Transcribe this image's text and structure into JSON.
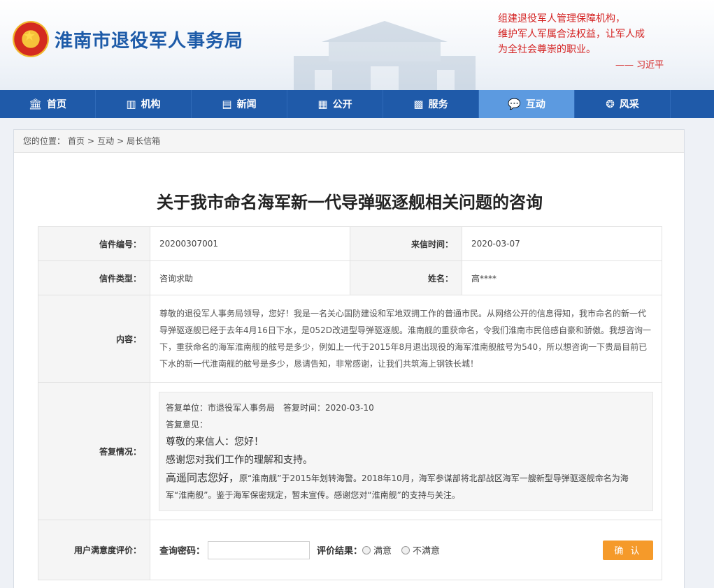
{
  "header": {
    "site_title": "淮南市退役军人事务局",
    "quote_lines": [
      "组建退役军人管理保障机构，",
      "维护军人军属合法权益，让军人成",
      "为全社会尊崇的职业。"
    ],
    "quote_author": "—— 习近平"
  },
  "nav": {
    "items": [
      {
        "label": "首页",
        "icon": "bank-icon",
        "glyph": "🏛"
      },
      {
        "label": "机构",
        "icon": "building-icon",
        "glyph": "▥"
      },
      {
        "label": "新闻",
        "icon": "news-icon",
        "glyph": "▤"
      },
      {
        "label": "公开",
        "icon": "clipboard-icon",
        "glyph": "▦"
      },
      {
        "label": "服务",
        "icon": "grid-icon",
        "glyph": "▩"
      },
      {
        "label": "互动",
        "icon": "chat-icon",
        "glyph": "💬"
      },
      {
        "label": "风采",
        "icon": "aperture-icon",
        "glyph": "❂"
      }
    ],
    "active_index": 5
  },
  "breadcrumb": {
    "prefix": "您的位置：",
    "items": [
      "首页",
      "互动",
      "局长信箱"
    ],
    "separator": ">"
  },
  "letter": {
    "title": "关于我市命名海军新一代导弹驱逐舰相关问题的咨询",
    "number_label": "信件编号：",
    "number": "20200307001",
    "time_label": "来信时间：",
    "time": "2020-03-07",
    "type_label": "信件类型：",
    "type": "咨询求助",
    "name_label": "姓名：",
    "name": "高****",
    "content_label": "内容：",
    "content": "尊敬的退役军人事务局领导，您好！我是一名关心国防建设和军地双拥工作的普通市民。从网络公开的信息得知，我市命名的新一代导弹驱逐舰已经于去年4月16日下水，是052D改进型导弹驱逐舰。淮南舰的重获命名，令我们淮南市民倍感自豪和骄傲。我想咨询一下，重获命名的海军淮南舰的舷号是多少，例如上一代于2015年8月退出现役的海军淮南舰舷号为540，所以想咨询一下贵局目前已下水的新一代淮南舰的舷号是多少，恳请告知，非常感谢，让我们共筑海上钢铁长城！"
  },
  "reply": {
    "label": "答复情况：",
    "unit_line": "答复单位：市退役军人事务局　答复时间：2020-03-10",
    "opinion_label": "答复意见：",
    "greeting": "尊敬的来信人：您好！",
    "thanks": "感谢您对我们工作的理解和支持。",
    "lead": "高遥同志您好，",
    "body": "原“淮南舰”于2015年划转海警。2018年10月，海军参谋部将北部战区海军一艘新型导弹驱逐舰命名为海军“淮南舰”。鉴于海军保密规定，暂未宣传。感谢您对“淮南舰”的支持与关注。"
  },
  "rating": {
    "label": "用户满意度评价：",
    "password_label": "查询密码：",
    "password_value": "",
    "result_label": "评价结果：",
    "option_satisfied": "满意",
    "option_unsatisfied": "不满意",
    "confirm_label": "确 认"
  },
  "colors": {
    "nav_bg": "#1f5aa9",
    "nav_active": "#5c9ae0",
    "title_blue": "#1d5ba8",
    "quote_red": "#d42222",
    "confirm_orange": "#f59a2a"
  }
}
